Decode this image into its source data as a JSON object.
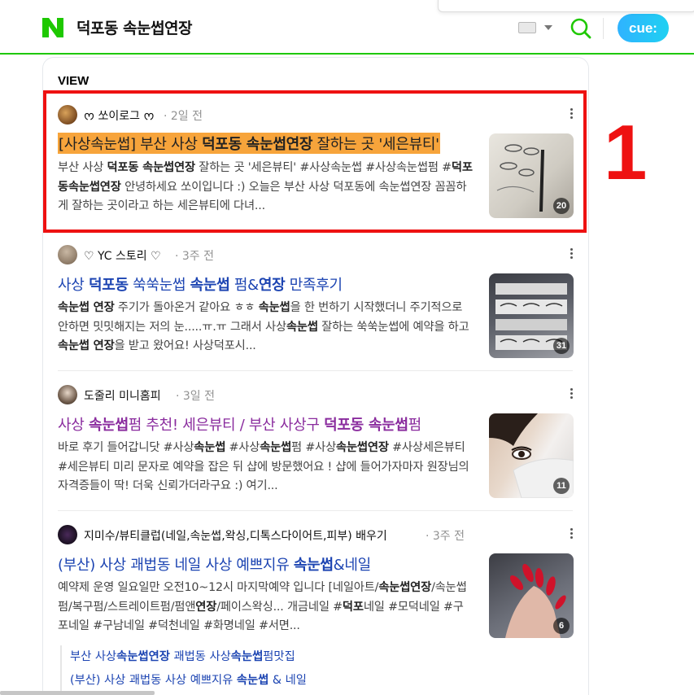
{
  "header": {
    "query": "덕포동 속눈썹연장",
    "cue_label": "cue:",
    "brand_color": "#1ec800"
  },
  "section_title": "VIEW",
  "annotation_number": "1",
  "posts": [
    {
      "author": "ᰔ 쏘이로그 ᰔ",
      "time": "· 2일 전",
      "title_segments": [
        {
          "t": "[사상속눈썹] 부산 사상 ",
          "b": false
        },
        {
          "t": "덕포동 속눈썹연장",
          "b": true
        },
        {
          "t": " 잘하는 곳 '세은뷰티'",
          "b": false
        }
      ],
      "desc_segments": [
        {
          "t": "부산 사상 ",
          "b": false
        },
        {
          "t": "덕포동 속눈썹연장",
          "b": true
        },
        {
          "t": " 잘하는 곳 '세은뷰티' #사상속눈썹 #사상속눈썹펌 #",
          "b": false
        },
        {
          "t": "덕포동속눈썹연장",
          "b": true
        },
        {
          "t": " 안녕하세요 쏘이입니다 :) 오늘은 부산 사상 덕포동에 속눈썹연장 꼼꼼하게 잘하는 곳이라고 하는 세은뷰티에 다녀...",
          "b": false
        }
      ],
      "thumb_count": "20"
    },
    {
      "author": "♡ YC 스토리 ♡",
      "time": "· 3주 전",
      "title_segments": [
        {
          "t": "사상 ",
          "b": false
        },
        {
          "t": "덕포동",
          "b": true
        },
        {
          "t": " 쑥쑥눈썹 ",
          "b": false
        },
        {
          "t": "속눈썹",
          "b": true
        },
        {
          "t": " 펌&",
          "b": false
        },
        {
          "t": "연장",
          "b": true
        },
        {
          "t": " 만족후기",
          "b": false
        }
      ],
      "desc_segments": [
        {
          "t": "속눈썹 연장",
          "b": true
        },
        {
          "t": " 주기가 돌아온거 같아요 ㅎㅎ ",
          "b": false
        },
        {
          "t": "속눈썹",
          "b": true
        },
        {
          "t": "을 한 번하기 시작했더니 주기적으로 안하면 밋밋해지는 저의 눈.....ㅠ.ㅠ 그래서 사상",
          "b": false
        },
        {
          "t": "속눈썹",
          "b": true
        },
        {
          "t": " 잘하는 쑥쑥눈썹에 예약을 하고 ",
          "b": false
        },
        {
          "t": "속눈썹 연장",
          "b": true
        },
        {
          "t": "을 받고 왔어요! 사상덕포시...",
          "b": false
        }
      ],
      "thumb_count": "31"
    },
    {
      "author": "도줄리 미니홈피",
      "time": "· 3일 전",
      "title_segments": [
        {
          "t": "사상 ",
          "b": false
        },
        {
          "t": "속눈썹",
          "b": true
        },
        {
          "t": "펌 추천! 세은뷰티 / 부산 사상구 ",
          "b": false
        },
        {
          "t": "덕포동 속눈썹",
          "b": true
        },
        {
          "t": "펌",
          "b": false
        }
      ],
      "desc_segments": [
        {
          "t": "바로 후기 들어갑니닷 #사상",
          "b": false
        },
        {
          "t": "속눈썹",
          "b": true
        },
        {
          "t": " #사상",
          "b": false
        },
        {
          "t": "속눈썹",
          "b": true
        },
        {
          "t": "펌 #사상",
          "b": false
        },
        {
          "t": "속눈썹연장",
          "b": true
        },
        {
          "t": " #사상세은뷰티 #세은뷰티 미리 문자로 예약을 잡은 뒤 샵에 방문했어요 ! 샵에 들어가자마자 원장님의 자격증들이 딱! 더욱 신뢰가더라구요 :) 여기...",
          "b": false
        }
      ],
      "thumb_count": "11"
    },
    {
      "author": "지미수/뷰티클럽(네일,속눈썹,왁싱,디톡스다이어트,피부) 배우기",
      "time": "· 3주 전",
      "title_segments": [
        {
          "t": "(부산) 사상 괘법동 네일 사상 예쁘지유 ",
          "b": false
        },
        {
          "t": "속눈썹",
          "b": true
        },
        {
          "t": "&네일",
          "b": false
        }
      ],
      "desc_segments": [
        {
          "t": "예약제 운영 일요일만 오전10~12시 마지막예약 입니다 [네일아트/",
          "b": false
        },
        {
          "t": "속눈썹연장",
          "b": true
        },
        {
          "t": "/속눈썹",
          "b": false
        },
        {
          "t": "펌",
          "b": false
        },
        {
          "t": "/복구펌/스트레이트펌/펌앤",
          "b": false
        },
        {
          "t": "연장",
          "b": true
        },
        {
          "t": "/페이스왁싱... 개금네일 #",
          "b": false
        },
        {
          "t": "덕포",
          "b": true
        },
        {
          "t": "네일 #모덕네일 #구포네일 #구남네일 #덕천네일 #화명네일 #서면...",
          "b": false
        }
      ],
      "thumb_count": "6"
    }
  ],
  "sublinks": [
    [
      {
        "t": "부산 사상",
        "b": false
      },
      {
        "t": "속눈썹연장",
        "b": true
      },
      {
        "t": " 괘법동 사상",
        "b": false
      },
      {
        "t": "속눈썹",
        "b": true
      },
      {
        "t": "펌맛집",
        "b": false
      }
    ],
    [
      {
        "t": "(부산) 사상 괘법동 사상 예쁘지유 ",
        "b": false
      },
      {
        "t": "속눈썹",
        "b": true
      },
      {
        "t": " & 네일",
        "b": false
      }
    ]
  ]
}
